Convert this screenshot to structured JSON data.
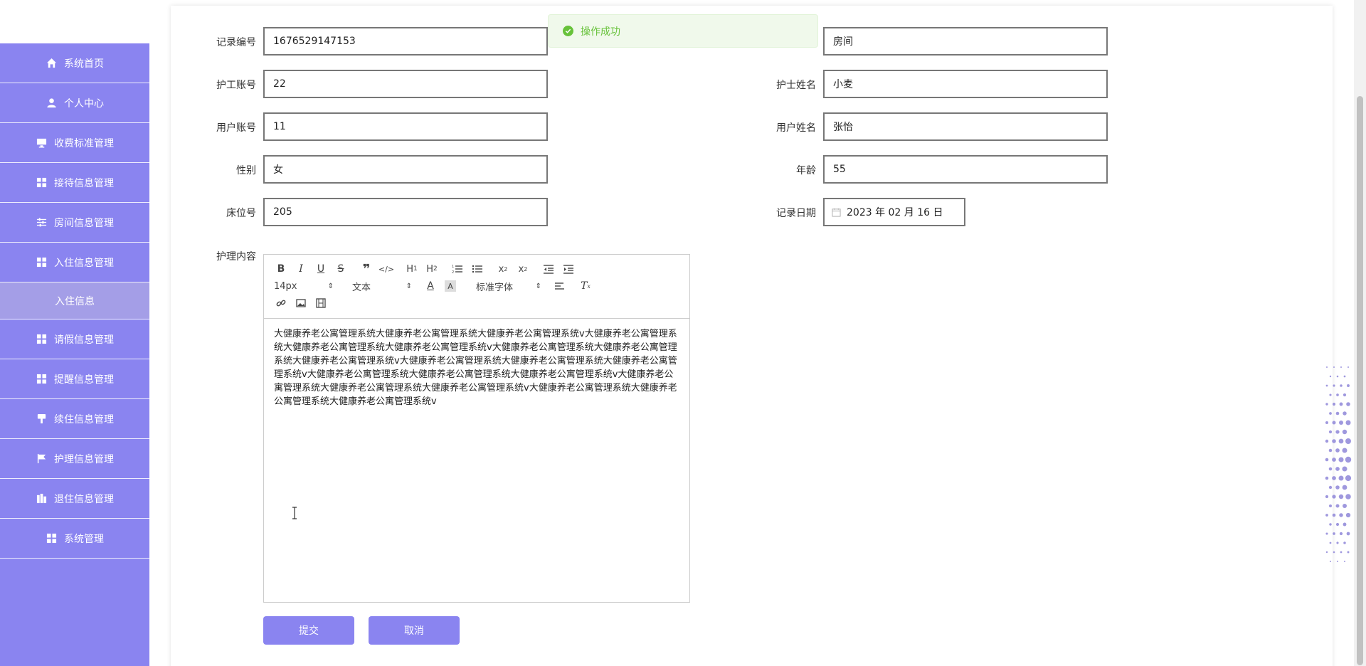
{
  "sidebar": {
    "items": [
      {
        "label": "系统首页",
        "icon": "home-icon"
      },
      {
        "label": "个人中心",
        "icon": "user-icon"
      },
      {
        "label": "收费标准管理",
        "icon": "monitor-icon"
      },
      {
        "label": "接待信息管理",
        "icon": "grid-icon"
      },
      {
        "label": "房间信息管理",
        "icon": "sliders-icon"
      },
      {
        "label": "入住信息管理",
        "icon": "grid-icon"
      }
    ],
    "active_sub": "入住信息",
    "items2": [
      {
        "label": "请假信息管理",
        "icon": "grid-icon"
      },
      {
        "label": "提醒信息管理",
        "icon": "grid-icon"
      },
      {
        "label": "续住信息管理",
        "icon": "brush-icon"
      },
      {
        "label": "护理信息管理",
        "icon": "flag-icon"
      },
      {
        "label": "退住信息管理",
        "icon": "building-icon"
      },
      {
        "label": "系统管理",
        "icon": "grid-icon"
      }
    ]
  },
  "toast": {
    "text": "操作成功",
    "color": "#67c23a"
  },
  "form": {
    "record_no": {
      "label": "记录编号",
      "value": "1676529147153"
    },
    "room": {
      "value": "房间"
    },
    "nurse_account": {
      "label": "护工账号",
      "value": "22"
    },
    "nurse_name": {
      "label": "护士姓名",
      "value": "小麦"
    },
    "user_account": {
      "label": "用户账号",
      "value": "11"
    },
    "user_name": {
      "label": "用户姓名",
      "value": "张怡"
    },
    "gender": {
      "label": "性别",
      "value": "女"
    },
    "age": {
      "label": "年龄",
      "value": "55"
    },
    "bed_no": {
      "label": "床位号",
      "value": "205"
    },
    "record_date": {
      "label": "记录日期",
      "value": "2023 年 02 月 16 日"
    },
    "content": {
      "label": "护理内容",
      "text": "大健康养老公寓管理系统大健康养老公寓管理系统大健康养老公寓管理系统v大健康养老公寓管理系统大健康养老公寓管理系统大健康养老公寓管理系统v大健康养老公寓管理系统大健康养老公寓管理系统大健康养老公寓管理系统v大健康养老公寓管理系统大健康养老公寓管理系统大健康养老公寓管理系统v大健康养老公寓管理系统大健康养老公寓管理系统大健康养老公寓管理系统v大健康养老公寓管理系统大健康养老公寓管理系统大健康养老公寓管理系统v大健康养老公寓管理系统大健康养老公寓管理系统大健康养老公寓管理系统v"
    }
  },
  "editor": {
    "font_size": "14px",
    "block_type": "文本",
    "font_family": "标准字体"
  },
  "buttons": {
    "submit": "提交",
    "cancel": "取消"
  },
  "colors": {
    "accent": "#8a84f0",
    "accent_light": "#a49ee7"
  }
}
